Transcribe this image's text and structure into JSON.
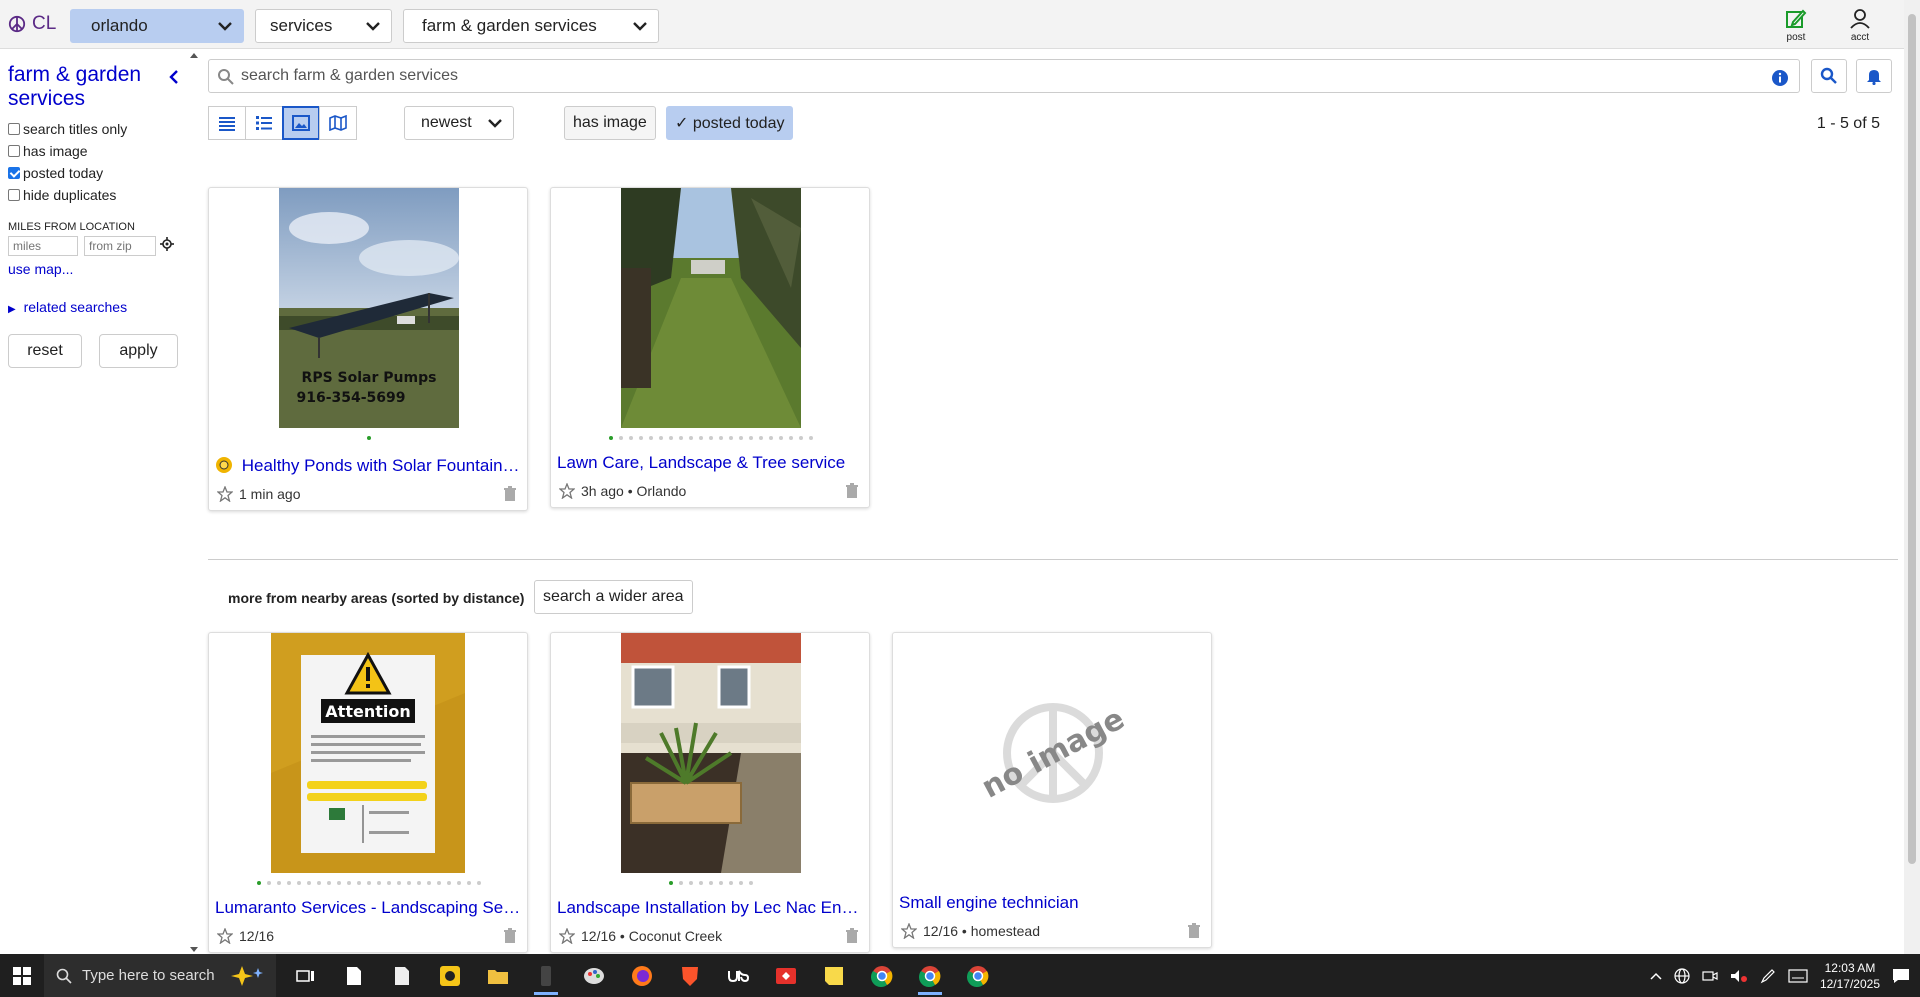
{
  "topbar": {
    "logo_text": "CL",
    "city": "orlando",
    "category": "services",
    "subcategory": "farm & garden services",
    "post_label": "post",
    "acct_label": "acct"
  },
  "sidebar": {
    "title": "farm & garden services",
    "filters": [
      {
        "label": "search titles only",
        "checked": false
      },
      {
        "label": "has image",
        "checked": false
      },
      {
        "label": "posted today",
        "checked": true
      },
      {
        "label": "hide duplicates",
        "checked": false
      }
    ],
    "miles_label": "MILES FROM LOCATION",
    "miles_placeholder": "miles",
    "zip_placeholder": "from zip",
    "use_map": "use map...",
    "related": "related searches",
    "reset": "reset",
    "apply": "apply"
  },
  "main": {
    "search_placeholder": "search farm & garden services",
    "sort": "newest",
    "has_image": "has image",
    "posted_today": "✓ posted today",
    "count": "1 - 5 of 5",
    "nearby_label": "more from nearby areas (sorted by distance)",
    "wider_button": "search a wider area",
    "no_image": "no image",
    "listings": [
      {
        "title": "Healthy Ponds with Solar Fountain P...",
        "meta": "1 min ago",
        "dots": 1,
        "image_text_1": "RPS Solar Pumps",
        "image_text_2": "916-354-5699"
      },
      {
        "title": "Lawn Care, Landscape & Tree service",
        "meta": "3h ago • Orlando",
        "dots": 21
      },
      {
        "title": "Lumaranto Services - Landscaping Servi...",
        "meta": "12/16",
        "dots": 23,
        "image_text_1": "Attention"
      },
      {
        "title": "Landscape Installation by Lec Nac Envir...",
        "meta": "12/16 • Coconut Creek",
        "dots": 9
      },
      {
        "title": "Small engine technician",
        "meta": "12/16 • homestead",
        "dots": 0
      }
    ]
  },
  "taskbar": {
    "search_placeholder": "Type here to search",
    "time": "12:03 AM",
    "date": "12/17/2025"
  },
  "colors": {
    "link": "#0000cc",
    "accent": "#b8cdf0",
    "brand": "#5b2a86"
  }
}
